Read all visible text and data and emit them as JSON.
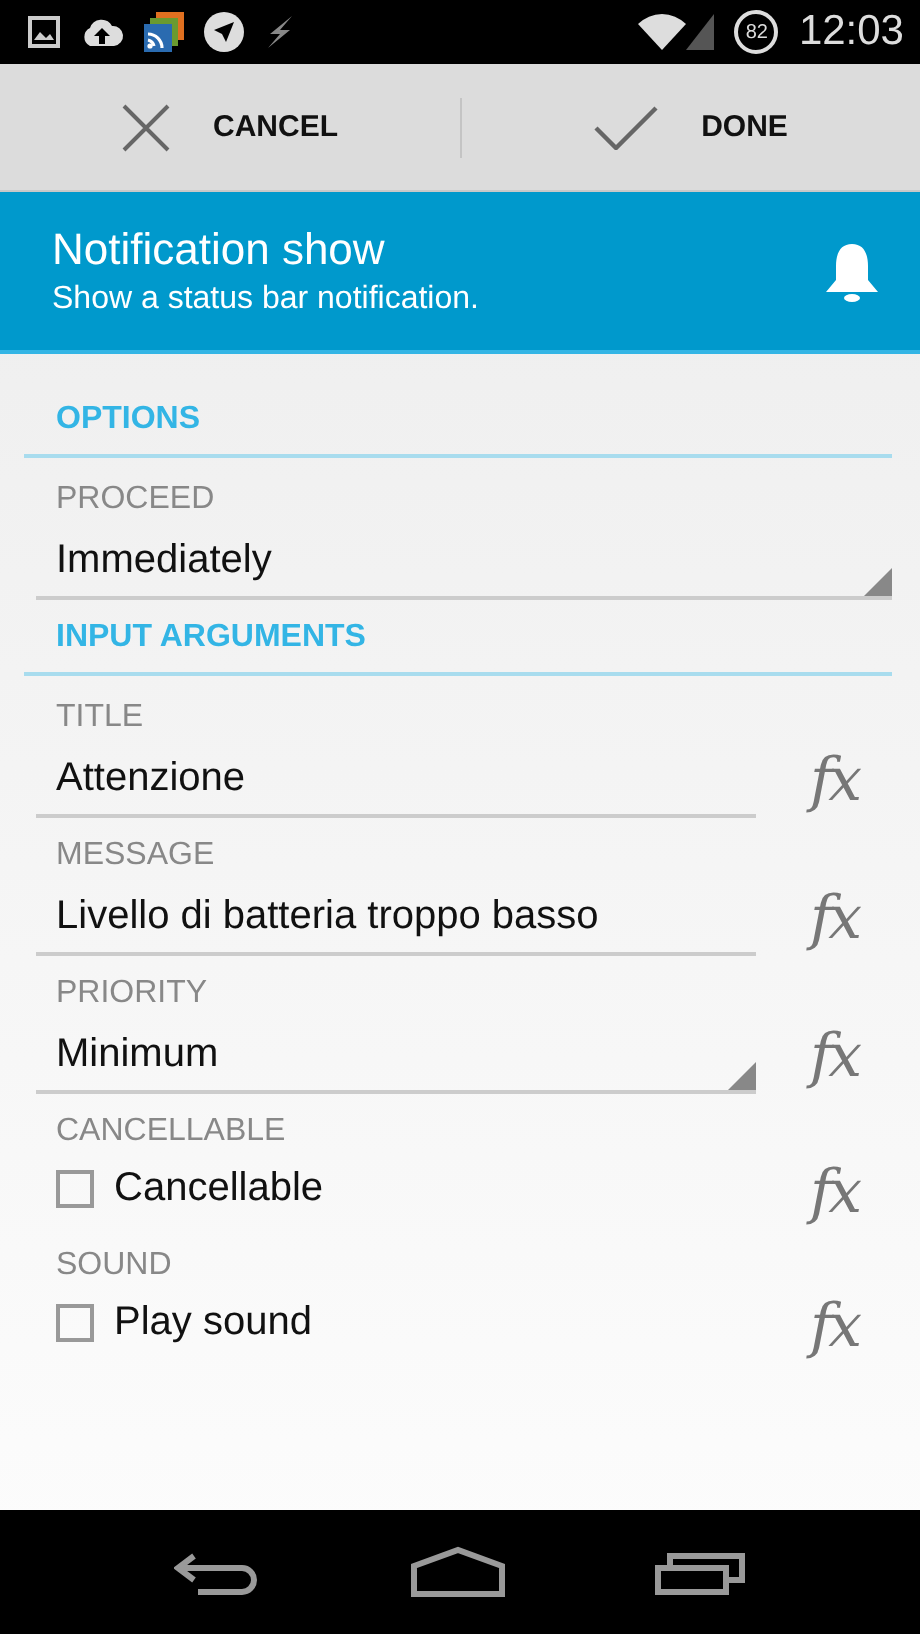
{
  "status_bar": {
    "battery": "82",
    "time": "12:03"
  },
  "action_bar": [
    {
      "kind": "cancel",
      "label": "CANCEL"
    },
    {
      "kind": "done",
      "label": "DONE"
    }
  ],
  "header": {
    "title": "Notification show",
    "subtitle": "Show a status bar notification."
  },
  "sections": [
    {
      "title": "OPTIONS",
      "fields": [
        {
          "kind": "spinner",
          "label": "PROCEED",
          "value": "Immediately"
        }
      ]
    },
    {
      "title": "INPUT ARGUMENTS",
      "fields": [
        {
          "kind": "text",
          "label": "TITLE",
          "value": "Attenzione",
          "fx": "fx"
        },
        {
          "kind": "text",
          "label": "MESSAGE",
          "value": "Livello di batteria troppo basso",
          "fx": "fx"
        },
        {
          "kind": "spinner",
          "label": "PRIORITY",
          "value": "Minimum",
          "fx": "fx"
        },
        {
          "kind": "checkbox",
          "label": "CANCELLABLE",
          "value": "Cancellable",
          "checked": false,
          "fx": "fx"
        },
        {
          "kind": "checkbox",
          "label": "SOUND",
          "value": "Play sound",
          "checked": false,
          "fx": "fx"
        }
      ]
    }
  ]
}
